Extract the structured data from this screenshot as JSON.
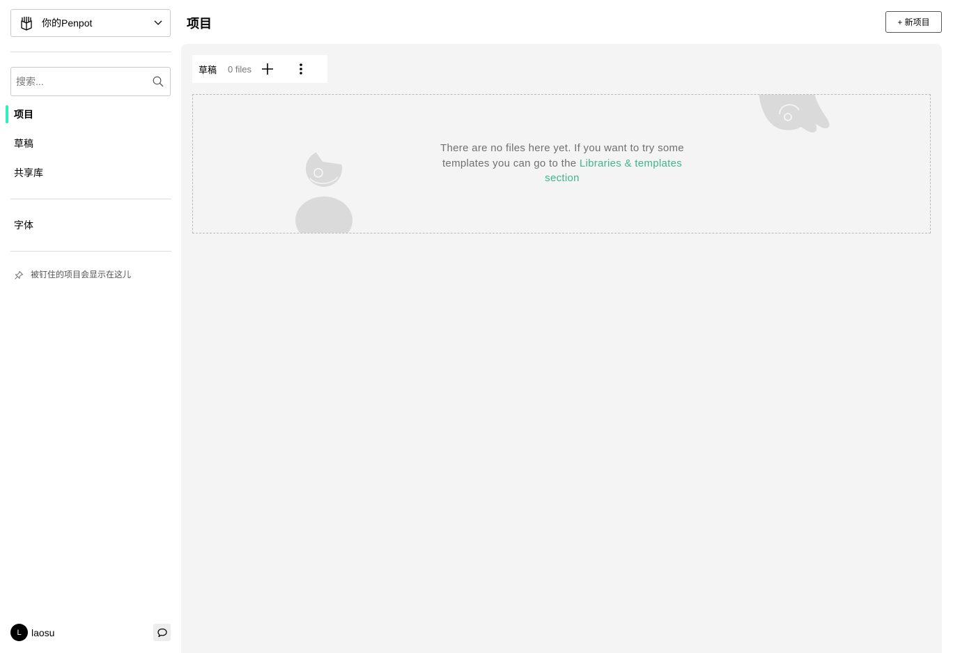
{
  "sidebar": {
    "team_name": "你的Penpot",
    "search_placeholder": "搜索...",
    "nav": {
      "projects": "项目",
      "drafts": "草稿",
      "libraries": "共享库",
      "fonts": "字体"
    },
    "pinned_empty": "被钉住的项目会显示在这儿",
    "profile": {
      "avatar_letter": "L",
      "name": "laosu"
    }
  },
  "header": {
    "title": "项目",
    "new_project_label": "+ 新项目"
  },
  "project": {
    "name": "草稿",
    "file_count": "0 files"
  },
  "empty_state": {
    "text": "There are no files here yet. If you want to try some templates you can go to the ",
    "link_text": "Libraries & templates section"
  },
  "colors": {
    "accent": "#31efb8",
    "link": "#3fb58a",
    "main_bg": "#f4f4f4"
  },
  "icons": {
    "team": "penpot-logo-icon",
    "dropdown": "chevron-down-icon",
    "search": "search-icon",
    "pin": "pin-icon",
    "add": "plus-icon",
    "menu": "vertical-dots-icon",
    "comments": "chat-bubble-icon"
  }
}
